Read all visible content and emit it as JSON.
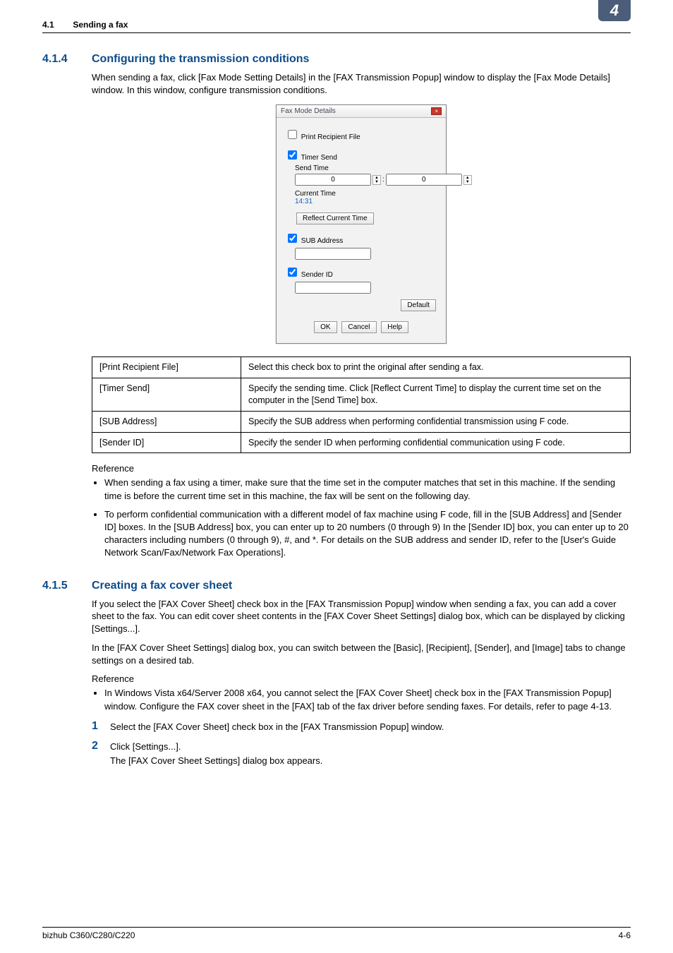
{
  "running_head": {
    "section_number": "4.1",
    "section_title": "Sending a fax",
    "chapter_number": "4"
  },
  "section_414": {
    "number": "4.1.4",
    "title": "Configuring the transmission conditions",
    "intro": "When sending a fax, click [Fax Mode Setting Details] in the [FAX Transmission Popup] window to display the [Fax Mode Details] window. In this window, configure transmission conditions."
  },
  "dialog": {
    "title": "Fax Mode Details",
    "print_recipient_file_label": "Print Recipient File",
    "timer_send_label": "Timer Send",
    "send_time_label": "Send Time",
    "send_hour": "0",
    "send_min": "0",
    "current_time_label": "Current Time",
    "current_time_value": "14:31",
    "reflect_button": "Reflect Current Time",
    "sub_address_label": "SUB Address",
    "sender_id_label": "Sender ID",
    "default_button": "Default",
    "ok_button": "OK",
    "cancel_button": "Cancel",
    "help_button": "Help"
  },
  "settings_table": [
    {
      "name": "[Print Recipient File]",
      "desc": "Select this check box to print the original after sending a fax."
    },
    {
      "name": "[Timer Send]",
      "desc": "Specify the sending time. Click [Reflect Current Time] to display the current time set on the computer in the [Send Time] box."
    },
    {
      "name": "[SUB Address]",
      "desc": "Specify the SUB address when performing confidential transmission using F code."
    },
    {
      "name": "[Sender ID]",
      "desc": "Specify the sender ID when performing confidential communication using F code."
    }
  ],
  "reference_414": {
    "label": "Reference",
    "items": [
      "When sending a fax using a timer, make sure that the time set in the computer matches that set in this machine. If the sending time is before the current time set in this machine, the fax will be sent on the following day.",
      "To perform confidential communication with a different model of fax machine using F code, fill in the [SUB Address] and [Sender ID] boxes. In the [SUB Address] box, you can enter up to 20 numbers (0 through 9) In the [Sender ID] box, you can enter up to 20 characters including numbers (0 through 9), #, and *. For details on the SUB address and sender ID, refer to the [User's Guide Network Scan/Fax/Network Fax Operations]."
    ]
  },
  "section_415": {
    "number": "4.1.5",
    "title": "Creating a fax cover sheet",
    "para1": "If you select the [FAX Cover Sheet] check box in the [FAX Transmission Popup] window when sending a fax, you can add a cover sheet to the fax. You can edit cover sheet contents in the [FAX Cover Sheet Settings] dialog box, which can be displayed by clicking [Settings...].",
    "para2": "In the [FAX Cover Sheet Settings] dialog box, you can switch between the [Basic], [Recipient], [Sender], and [Image] tabs to change settings on a desired tab.",
    "reference_label": "Reference",
    "reference_items": [
      "In Windows Vista x64/Server 2008 x64, you cannot select the [FAX Cover Sheet] check box in the [FAX Transmission Popup] window. Configure the FAX cover sheet in the [FAX] tab of the fax driver before sending faxes. For details, refer to page 4-13."
    ],
    "steps": [
      {
        "num": "1",
        "text": "Select the [FAX Cover Sheet] check box in the [FAX Transmission Popup] window."
      },
      {
        "num": "2",
        "text": "Click [Settings...]."
      }
    ],
    "step2_sub": "The [FAX Cover Sheet Settings] dialog box appears."
  },
  "footer": {
    "left": "bizhub C360/C280/C220",
    "right": "4-6"
  }
}
